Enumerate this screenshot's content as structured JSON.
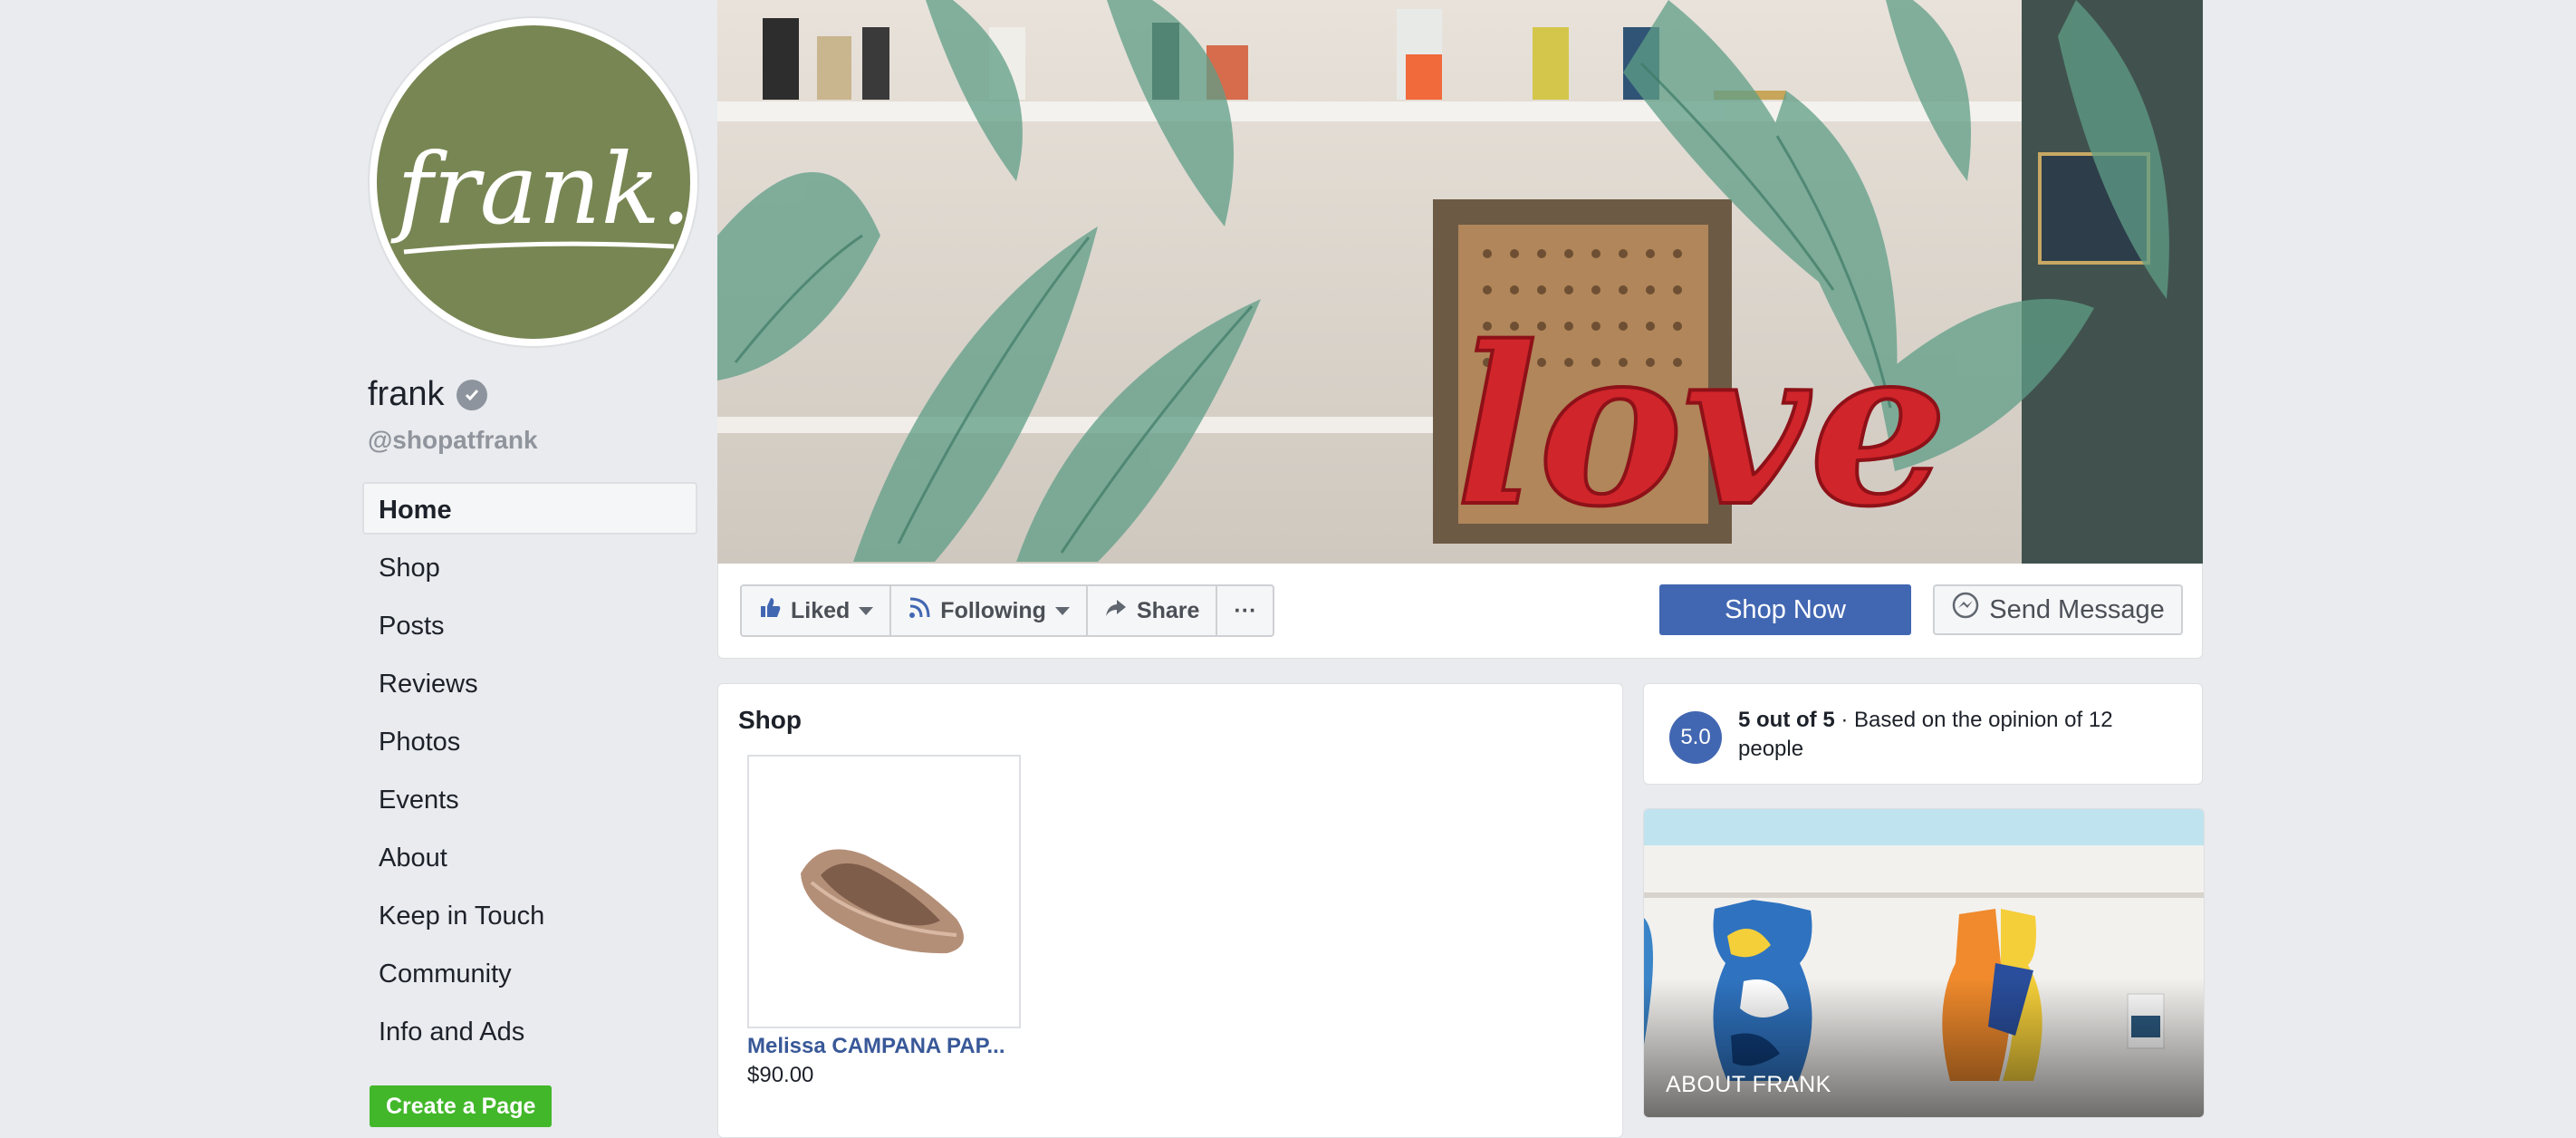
{
  "page": {
    "name": "frank",
    "handle": "@shopatfrank",
    "logo_text": "frank."
  },
  "nav": {
    "items": [
      {
        "label": "Home",
        "active": true
      },
      {
        "label": "Shop"
      },
      {
        "label": "Posts"
      },
      {
        "label": "Reviews"
      },
      {
        "label": "Photos"
      },
      {
        "label": "Events"
      },
      {
        "label": "About"
      },
      {
        "label": "Keep in Touch"
      },
      {
        "label": "Community"
      },
      {
        "label": "Info and Ads"
      }
    ],
    "create_page": "Create a Page"
  },
  "cover": {
    "balloon_text": "love"
  },
  "actions": {
    "liked": "Liked",
    "following": "Following",
    "share": "Share",
    "more": "···",
    "shop_now": "Shop Now",
    "send_message": "Send Message"
  },
  "shop": {
    "title": "Shop",
    "product": {
      "name": "Melissa CAMPANA PAP...",
      "price": "$90.00"
    }
  },
  "rating": {
    "score": "5.0",
    "bold": "5 out of 5",
    "rest": " · Based on the opinion of 12 people"
  },
  "about": {
    "label": "ABOUT FRANK"
  },
  "colors": {
    "brand_blue": "#4267b2",
    "link_blue": "#385898",
    "logo_green": "#788653",
    "create_green": "#42b72a",
    "page_bg": "#e9ebee"
  },
  "icons": [
    "check-icon",
    "thumbs-up-icon",
    "rss-icon",
    "share-arrow-icon",
    "messenger-icon",
    "caret-down-icon"
  ]
}
